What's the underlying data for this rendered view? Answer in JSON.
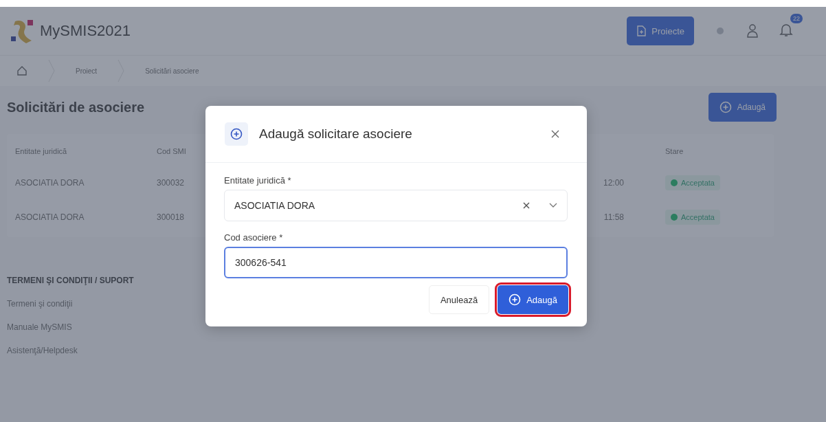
{
  "header": {
    "app_title": "MySMIS2021",
    "projects_button": "Proiecte",
    "notification_count": "22"
  },
  "breadcrumb": [
    "Proiect",
    "Solicitări asociere"
  ],
  "page": {
    "title": "Solicitări de asociere",
    "add_button": "Adaugă"
  },
  "table": {
    "columns": [
      "Entitate juridică",
      "Cod SMI",
      "",
      "Stare"
    ],
    "rows": [
      {
        "entity": "ASOCIATIA DORA",
        "code": "300032",
        "time": "12:00",
        "status": "Acceptata",
        "color": "#2b7d5f"
      },
      {
        "entity": "ASOCIATIA DORA",
        "code": "300018",
        "time": "11:58",
        "status": "Acceptata",
        "color": "#2b7d5f"
      }
    ]
  },
  "footer": {
    "heading": "TERMENI ŞI CONDIŢII / SUPORT",
    "links": [
      "Termeni şi condiţii",
      "Manuale MySMIS",
      "Asistenţă/Helpdesk"
    ]
  },
  "dialog": {
    "title": "Adaugă solicitare asociere",
    "fields": [
      {
        "kind": "select",
        "label": "Entitate juridică *",
        "value": "ASOCIATIA DORA",
        "focused": false
      },
      {
        "kind": "text",
        "label": "Cod asociere *",
        "value": "300626-541",
        "focused": true
      }
    ],
    "buttons": [
      {
        "kind": "secondary",
        "label": "Anulează",
        "highlighted": false
      },
      {
        "kind": "primary",
        "label": "Adaugă",
        "highlighted": true
      }
    ]
  }
}
